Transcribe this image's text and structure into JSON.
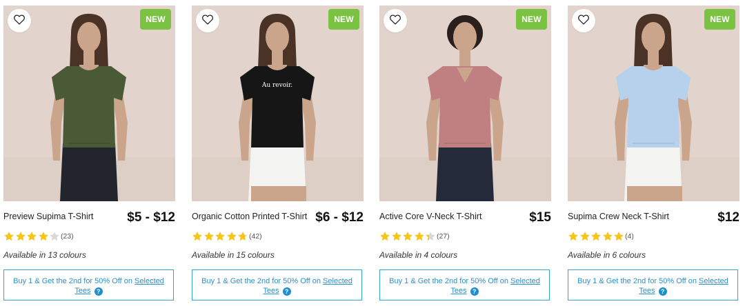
{
  "colors": {
    "badge": "#7cc242",
    "star_filled": "#f5c518",
    "star_empty": "#d9d9d9",
    "promo_border": "#2ea3d9",
    "promo_text": "#2b8fc8",
    "image_bg": "#e2d4cc"
  },
  "icons": {
    "wishlist": "heart-outline-icon",
    "help": "question-circle-icon",
    "rating": "star-icon"
  },
  "products": [
    {
      "name": "Preview Supima T-Shirt",
      "price": "$5 - $12",
      "badge": "NEW",
      "rating": 4,
      "review_count": "(23)",
      "colours": "Available in 13 colours",
      "promo_text": "Buy 1 & Get the 2nd for 50% Off on ",
      "promo_link_1": "Selected",
      "promo_link_2": "Tees",
      "help": "?",
      "shirt_color": "#4b5a36",
      "shirt_style": "crew",
      "bottom_color": "#22252c"
    },
    {
      "name": "Organic Cotton Printed T-Shirt",
      "price": "$6 - $12",
      "badge": "NEW",
      "rating": 4.7,
      "review_count": "(42)",
      "colours": "Available in 15 colours",
      "promo_text": "Buy 1 & Get the 2nd for 50% Off on ",
      "promo_link_1": "Selected",
      "promo_link_2": "Tees",
      "help": "?",
      "shirt_color": "#161616",
      "shirt_style": "crew",
      "shirt_print": "Au revoir.",
      "bottom_color": "#f3f3f1"
    },
    {
      "name": "Active Core V-Neck T-Shirt",
      "price": "$15",
      "badge": "NEW",
      "rating": 4.4,
      "review_count": "(27)",
      "colours": "Available in 4 colours",
      "promo_text": "Buy 1 & Get the 2nd for 50% Off on ",
      "promo_link_1": "Selected",
      "promo_link_2": "Tees",
      "help": "?",
      "shirt_color": "#c07f80",
      "shirt_style": "vneck",
      "bottom_color": "#242a3a"
    },
    {
      "name": "Supima Crew Neck T-Shirt",
      "price": "$12",
      "badge": "NEW",
      "rating": 5,
      "review_count": "(4)",
      "colours": "Available in 6 colours",
      "promo_text": "Buy 1 & Get the 2nd for 50% Off on ",
      "promo_link_1": "Selected",
      "promo_link_2": "Tees",
      "help": "?",
      "shirt_color": "#b7d1ec",
      "shirt_style": "crew",
      "bottom_color": "#f3f3f1"
    }
  ]
}
